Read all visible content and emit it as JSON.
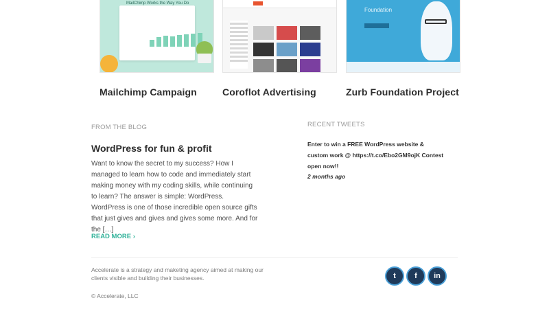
{
  "portfolio": {
    "items": [
      {
        "title": "Mailchimp Campaign",
        "thumb_heading": "MailChimp Works the Way You Do"
      },
      {
        "title": "Coroflot Advertising"
      },
      {
        "title": "Zurb Foundation Project",
        "thumb_heading": "Foundation"
      }
    ]
  },
  "blog": {
    "section_label": "FROM THE BLOG",
    "post_title": "WordPress for fun & profit",
    "excerpt": "Want to know the secret to my success? How I managed to learn how to code and immediately start making money with my coding skills, while continuing to learn? The answer is simple: WordPress. WordPress is one of those incredible open source gifts that just gives and gives and gives some more. And for the […]",
    "read_more": "READ MORE ›"
  },
  "tweets": {
    "section_label": "RECENT TWEETS",
    "text": "Enter to win a FREE WordPress website & custom work @ https://t.co/Ebo2GM9ojK Contest open now!!",
    "time": "2 months ago"
  },
  "footer": {
    "about": "Accelerate is a strategy and maketing agency aimed at making our clients visible and building their businesses.",
    "copyright": "© Accelerate, LLC",
    "social": [
      {
        "icon": "twitter-icon",
        "glyph": "t"
      },
      {
        "icon": "facebook-icon",
        "glyph": "f"
      },
      {
        "icon": "linkedin-icon",
        "glyph": "in"
      }
    ]
  },
  "colors": {
    "accent": "#2fb198",
    "social_bg": "#1f3a5a",
    "social_border": "#4aa0d8"
  }
}
